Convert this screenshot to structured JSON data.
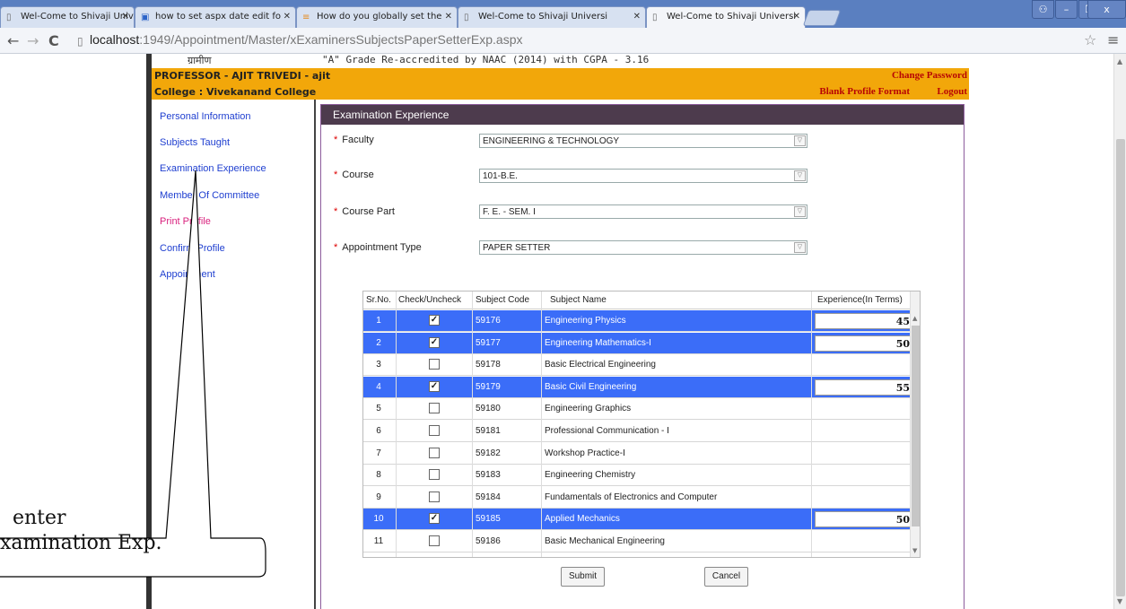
{
  "browser": {
    "tabs": [
      {
        "label": "Wel-Come to Shivaji Universi"
      },
      {
        "label": "how to set aspx date edit fo"
      },
      {
        "label": "How do you globally set the"
      },
      {
        "label": "Wel-Come to Shivaji Universi"
      },
      {
        "label": "Wel-Come to Shivaji Universi"
      }
    ],
    "url_host": "localhost",
    "url_path": ":1949/Appointment/Master/xExaminersSubjectsPaperSetterExp.aspx"
  },
  "site": {
    "top_left": "ग्रामीण",
    "top_mid": "\"A\" Grade Re-accredited by NAAC (2014) with CGPA - 3.16",
    "professor": "PROFESSOR - AJIT TRIVEDI - ajit",
    "college": "College : Vivekanand College",
    "change_password": "Change Password",
    "blank_profile": "Blank Profile Format",
    "logout": "Logout"
  },
  "sidebar": {
    "items": [
      {
        "label": "Personal Information"
      },
      {
        "label": "Subjects Taught"
      },
      {
        "label": "Examination Experience"
      },
      {
        "label": "Member Of Committee"
      },
      {
        "label": "Print Profile"
      },
      {
        "label": "Confirm Profile"
      },
      {
        "label": "Appointment"
      }
    ]
  },
  "form": {
    "title": "Examination Experience",
    "faculty_label": "Faculty",
    "faculty_value": "ENGINEERING & TECHNOLOGY",
    "course_label": "Course",
    "course_value": "101-B.E.",
    "course_part_label": "Course Part",
    "course_part_value": "F. E. - SEM. I",
    "appt_label": "Appointment Type",
    "appt_value": "PAPER SETTER",
    "submit": "Submit",
    "cancel": "Cancel"
  },
  "grid": {
    "headers": {
      "srno": "Sr.No.",
      "check": "Check/Uncheck",
      "code": "Subject Code",
      "name": "Subject Name",
      "exp": "Experience(In Terms)"
    },
    "rows": [
      {
        "sr": "1",
        "code": "59176",
        "name": "Engineering Physics",
        "checked": true,
        "exp": "45"
      },
      {
        "sr": "2",
        "code": "59177",
        "name": "Engineering Mathematics-I",
        "checked": true,
        "exp": "50"
      },
      {
        "sr": "3",
        "code": "59178",
        "name": "Basic Electrical Engineering",
        "checked": false,
        "exp": ""
      },
      {
        "sr": "4",
        "code": "59179",
        "name": "Basic Civil Engineering",
        "checked": true,
        "exp": "55"
      },
      {
        "sr": "5",
        "code": "59180",
        "name": "Engineering Graphics",
        "checked": false,
        "exp": ""
      },
      {
        "sr": "6",
        "code": "59181",
        "name": "Professional Communication - I",
        "checked": false,
        "exp": ""
      },
      {
        "sr": "7",
        "code": "59182",
        "name": "Workshop Practice-I",
        "checked": false,
        "exp": ""
      },
      {
        "sr": "8",
        "code": "59183",
        "name": "Engineering Chemistry",
        "checked": false,
        "exp": ""
      },
      {
        "sr": "9",
        "code": "59184",
        "name": "Fundamentals of Electronics and Computer",
        "checked": false,
        "exp": ""
      },
      {
        "sr": "10",
        "code": "59185",
        "name": "Applied Mechanics",
        "checked": true,
        "exp": "50"
      },
      {
        "sr": "11",
        "code": "59186",
        "name": "Basic Mechanical Engineering",
        "checked": false,
        "exp": ""
      }
    ]
  },
  "callout": {
    "line1": "  enter",
    "line2": "xamination Exp."
  },
  "colors": {
    "header_bg": "#f2a70a",
    "selected_row": "#3b6df8",
    "panel_head": "#4d3b4d",
    "link": "#1f3fd0",
    "link_alt": "#d9227e",
    "alert_text": "#b70505"
  }
}
